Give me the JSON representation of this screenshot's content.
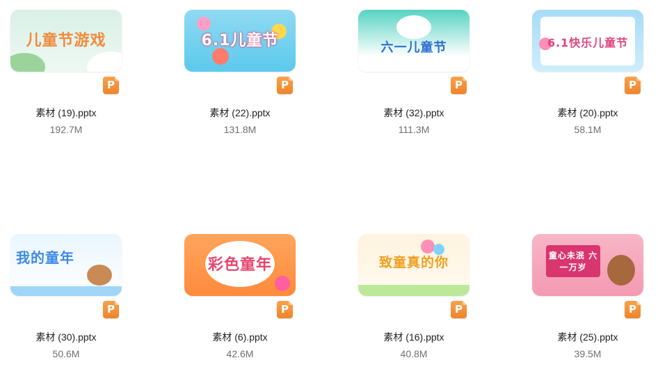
{
  "files": [
    {
      "name": "素材 (19).pptx",
      "size": "192.7M",
      "thumb_text": "儿童节游戏",
      "thumb_color": "#f08a3a"
    },
    {
      "name": "素材 (22).pptx",
      "size": "131.8M",
      "thumb_text": "6.1儿童节",
      "thumb_color": "#ffffff"
    },
    {
      "name": "素材 (32).pptx",
      "size": "111.3M",
      "thumb_text": "六一儿童节",
      "thumb_color": "#2f6fd0"
    },
    {
      "name": "素材 (20).pptx",
      "size": "58.1M",
      "thumb_text": "6.1快乐儿童节",
      "thumb_color": "#e0467e"
    },
    {
      "name": "素材 (30).pptx",
      "size": "50.6M",
      "thumb_text": "我的童年",
      "thumb_color": "#3d8ae6"
    },
    {
      "name": "素材 (6).pptx",
      "size": "42.6M",
      "thumb_text": "彩色童年",
      "thumb_color": "#e8456e"
    },
    {
      "name": "素材 (16).pptx",
      "size": "40.8M",
      "thumb_text": "致童真的你",
      "thumb_color": "#f0a020"
    },
    {
      "name": "素材 (25).pptx",
      "size": "39.5M",
      "thumb_text": "童心未泯 六一万岁",
      "thumb_color": "#ffffff"
    }
  ],
  "badge_label": "P",
  "badge_icon": "pptx-file-icon"
}
